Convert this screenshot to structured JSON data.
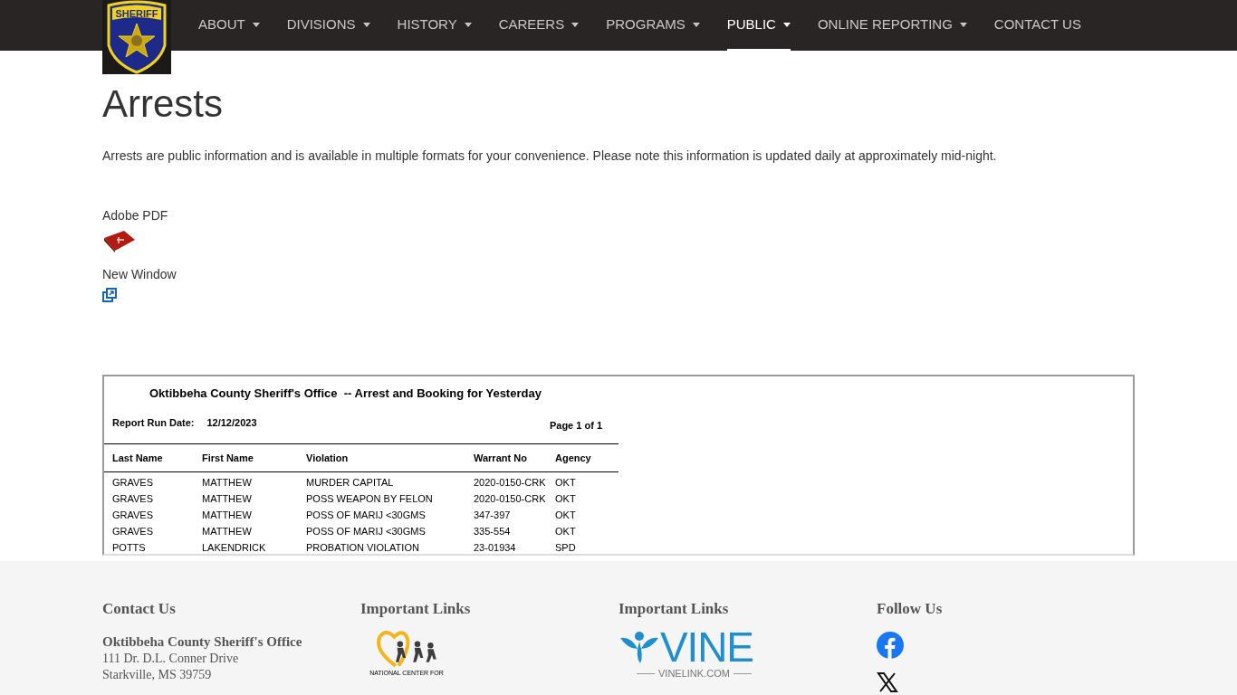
{
  "logo": {
    "text": "SHERIFF"
  },
  "nav": [
    {
      "label": "ABOUT",
      "dropdown": true,
      "selected": false
    },
    {
      "label": "DIVISIONS",
      "dropdown": true,
      "selected": false
    },
    {
      "label": "HISTORY",
      "dropdown": true,
      "selected": false
    },
    {
      "label": "CAREERS",
      "dropdown": true,
      "selected": false
    },
    {
      "label": "PROGRAMS",
      "dropdown": true,
      "selected": false
    },
    {
      "label": "PUBLIC",
      "dropdown": true,
      "selected": true
    },
    {
      "label": "ONLINE REPORTING",
      "dropdown": true,
      "selected": false
    },
    {
      "label": "CONTACT US",
      "dropdown": false,
      "selected": false
    }
  ],
  "page": {
    "title": "Arrests",
    "intro": "Arrests are public information and is available in multiple formats for your convenience. Please note this information is updated daily at approximately mid-night."
  },
  "formats": [
    {
      "label": "Adobe PDF",
      "kind": "pdf"
    },
    {
      "label": "New Window",
      "kind": "window"
    }
  ],
  "report": {
    "title": "Oktibbeha County Sheriff's Office  -- Arrest and Booking for Yesterday",
    "run_date_label": "Report Run Date:",
    "run_date": "12/12/2023",
    "page": "Page 1 of 1",
    "columns": [
      "Last Name",
      "First Name",
      "Violation",
      "Warrant No",
      "Agency"
    ],
    "rows": [
      [
        "GRAVES",
        "MATTHEW",
        "MURDER CAPITAL",
        "2020-0150-CRK",
        "OKT"
      ],
      [
        "GRAVES",
        "MATTHEW",
        "POSS WEAPON BY FELON",
        "2020-0150-CRK",
        "OKT"
      ],
      [
        "GRAVES",
        "MATTHEW",
        "POSS OF MARIJ <30GMS",
        "347-397",
        "OKT"
      ],
      [
        "GRAVES",
        "MATTHEW",
        "POSS OF MARIJ <30GMS",
        "335-554",
        "OKT"
      ],
      [
        "POTTS",
        "LAKENDRICK",
        "PROBATION VIOLATION",
        "23-01934",
        "SPD"
      ]
    ]
  },
  "footer": {
    "contact": {
      "heading": "Contact Us",
      "name": "Oktibbeha County Sheriff's Office",
      "address": [
        "111 Dr. D.L. Conner Drive",
        "Starkville, MS 39759"
      ]
    },
    "links_1": {
      "heading": "Important Links",
      "logo_text": "NATIONAL CENTER FOR"
    },
    "links_2": {
      "heading": "Important Links",
      "logo_text": "VINE",
      "logo_subtext": "VINELINK.COM"
    },
    "follow": {
      "heading": "Follow Us"
    }
  }
}
